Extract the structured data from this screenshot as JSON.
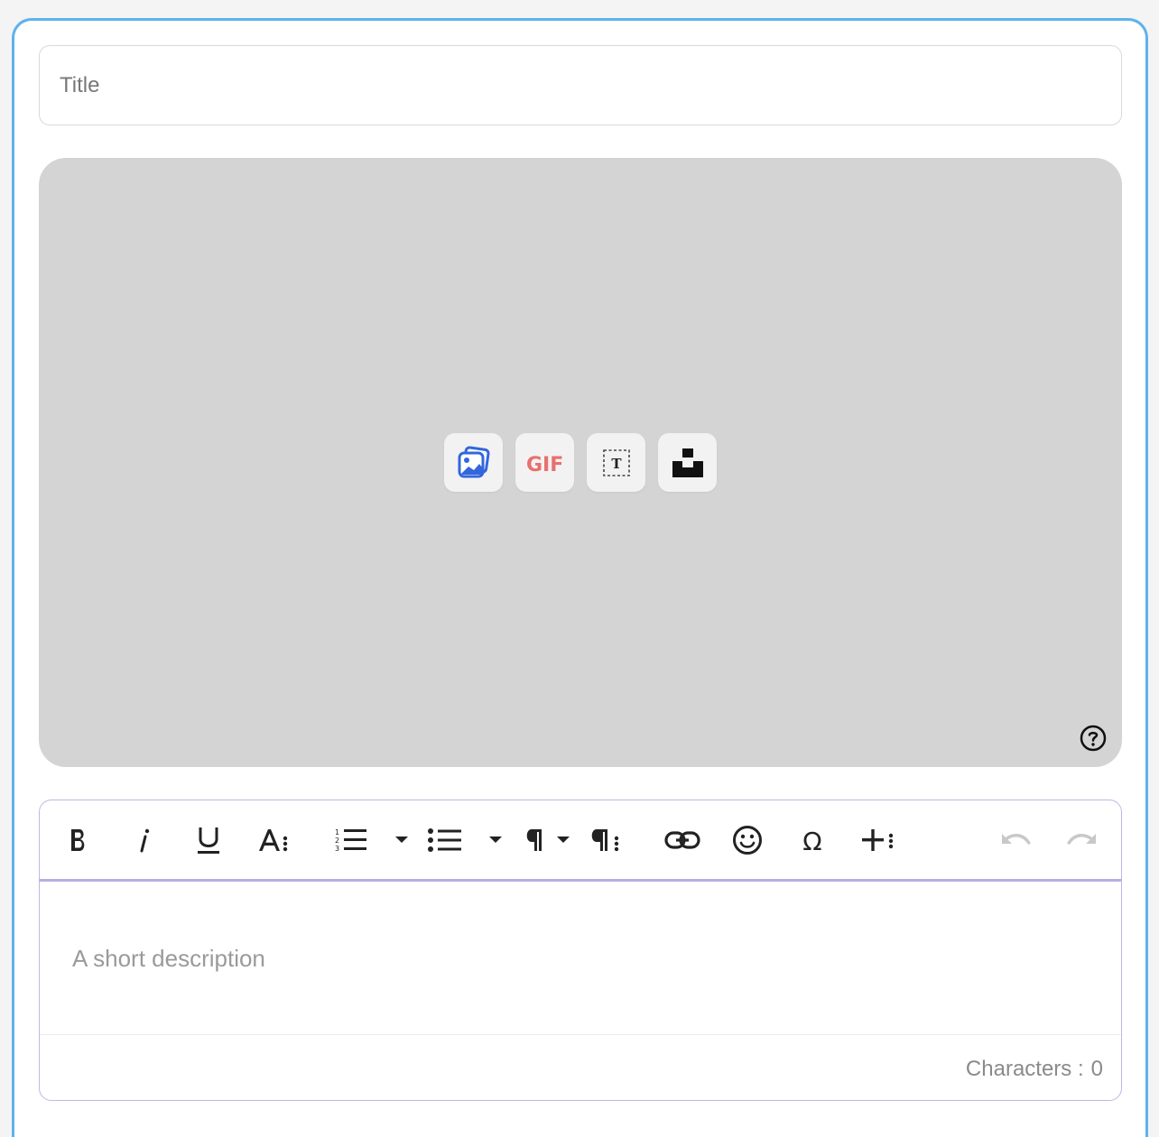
{
  "form": {
    "title_placeholder": "Title",
    "title_value": ""
  },
  "media": {
    "buttons": [
      {
        "name": "image",
        "icon": "image-upload-icon",
        "color": "#3366dd"
      },
      {
        "name": "gif",
        "icon": "gif-icon",
        "label": "GIF",
        "color": "#e96f6f"
      },
      {
        "name": "text",
        "icon": "text-box-icon",
        "label": "T",
        "color": "#222222"
      },
      {
        "name": "unsplash",
        "icon": "unsplash-icon",
        "color": "#111111"
      }
    ],
    "background": "#d4d4d4",
    "help_icon": "question-circle-icon"
  },
  "editor": {
    "placeholder": "A short description",
    "toolbar": [
      "bold-icon",
      "italic-icon",
      "underline-icon",
      "font-style-icon",
      "ordered-list-icon",
      "ordered-list-dropdown-icon",
      "bullet-list-icon",
      "bullet-list-dropdown-icon",
      "paragraph-format-icon",
      "paragraph-style-icon",
      "link-icon",
      "emoji-icon",
      "special-characters-icon",
      "insert-more-icon",
      "undo-icon",
      "redo-icon"
    ],
    "char_count_label": "Characters :",
    "char_count_value": "0",
    "accent": "#b7aee6"
  },
  "colors": {
    "card_border": "#5cb3ec"
  }
}
